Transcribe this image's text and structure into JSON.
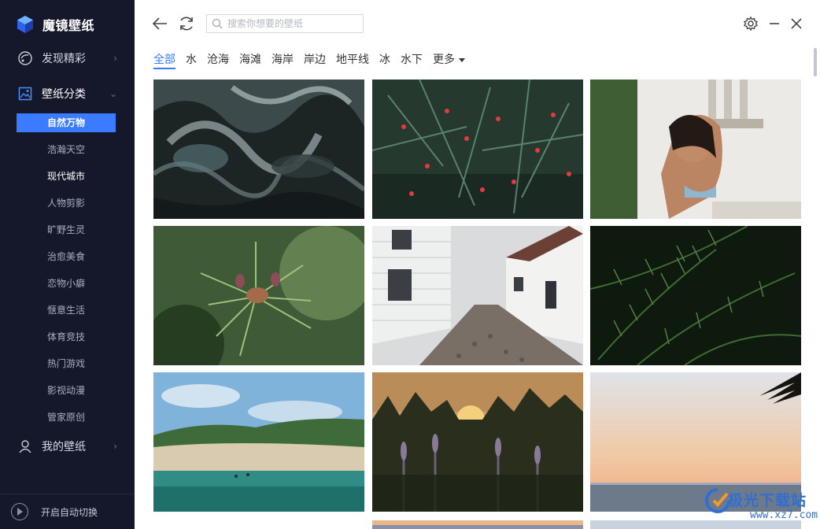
{
  "app": {
    "name": "魔镜壁纸"
  },
  "sidebar": {
    "discover": "发现精彩",
    "categories": "壁纸分类",
    "active_sub": "自然万物",
    "sub_items": [
      "浩瀚天空",
      "现代城市",
      "人物剪影",
      "旷野生灵",
      "治愈美食",
      "恋物小癖",
      "惬意生活",
      "体育竞技",
      "热门游戏",
      "影视动漫",
      "管家原创"
    ],
    "my_wallpapers": "我的壁纸",
    "auto_switch": "开启自动切换"
  },
  "toolbar": {
    "search_placeholder": "搜索你想要的壁纸"
  },
  "tabs": [
    "全部",
    "水",
    "沧海",
    "海滩",
    "海岸",
    "岸边",
    "地平线",
    "冰",
    "水下",
    "更多"
  ],
  "active_tab": "全部",
  "grid": {
    "tiles": [
      "abstract-marble-fluid",
      "pine-branch-red-berries",
      "woman-bikini-bench",
      "pine-cone-closeup",
      "white-houses-cobblestone-street",
      "dark-fern-leaves",
      "lake-beach-sand-dunes",
      "sunset-meadow-lupines",
      "sunset-sea-horizon-palm"
    ]
  },
  "watermark": {
    "text": "极光下载站",
    "url": "www.xz7.com"
  },
  "colors": {
    "sidebar_bg": "#15182b",
    "accent": "#3b7bff"
  }
}
